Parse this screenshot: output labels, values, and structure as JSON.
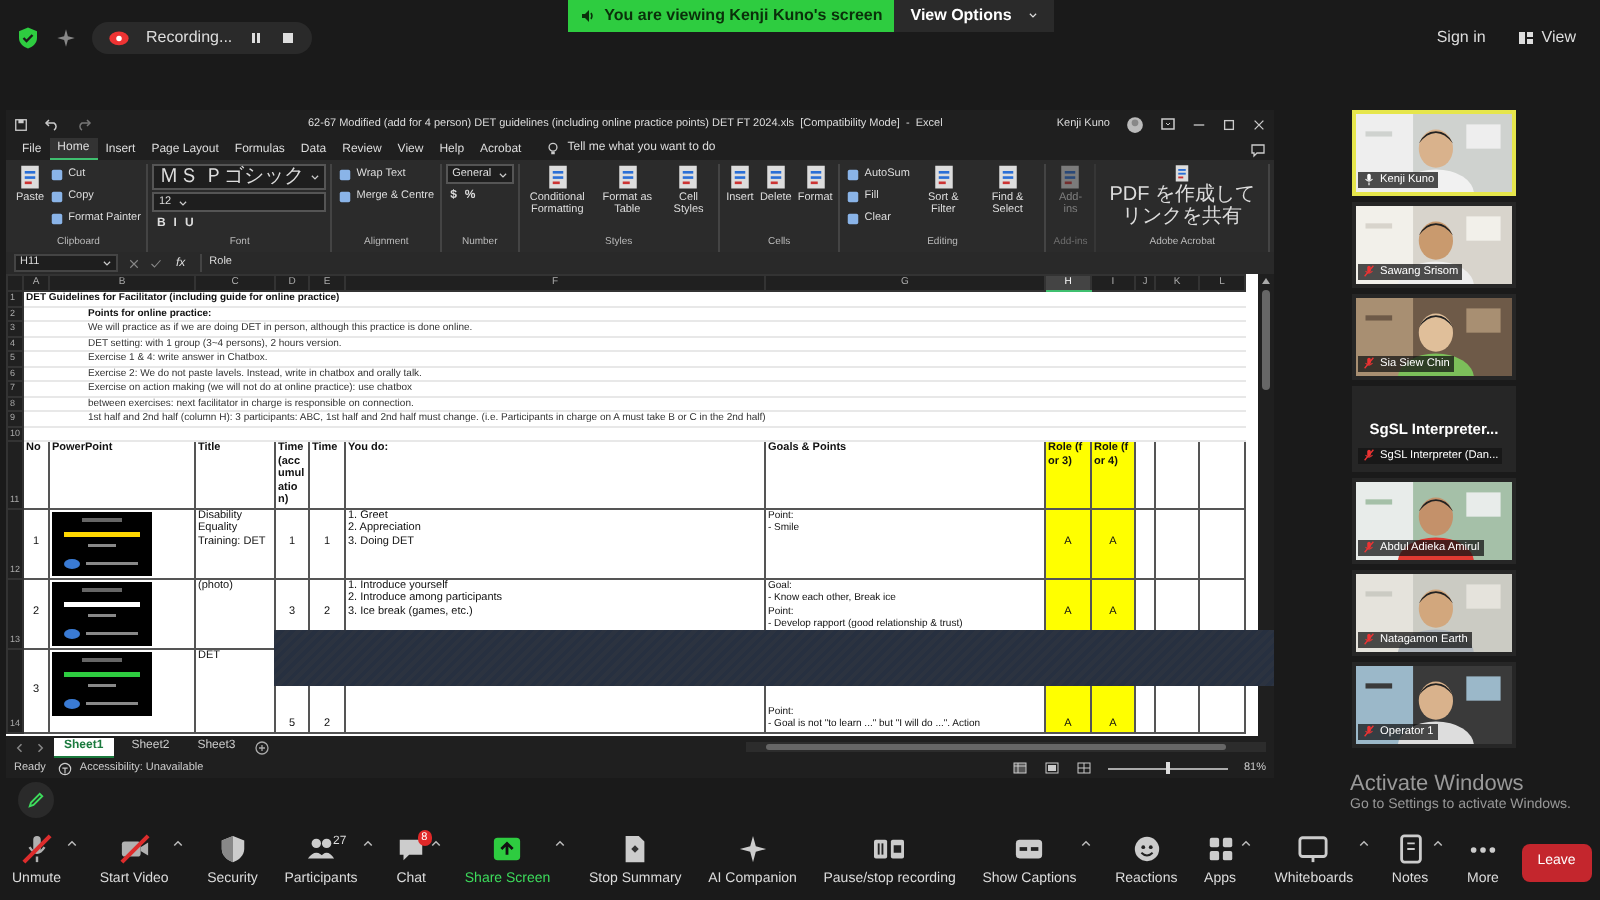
{
  "top_bar": {
    "recording": "Recording...",
    "banner": "You are viewing Kenji Kuno's screen",
    "view_options": "View Options",
    "sign_in": "Sign in",
    "view": "View"
  },
  "excel": {
    "title": "62-67 Modified (add for 4 person) DET guidelines (including online practice points) DET FT 2024.xls  [Compatibility Mode]  -  Excel",
    "user": "Kenji Kuno",
    "menu_tabs": [
      {
        "label": "File",
        "selected": false
      },
      {
        "label": "Home",
        "selected": true
      },
      {
        "label": "Insert",
        "selected": false
      },
      {
        "label": "Page Layout",
        "selected": false
      },
      {
        "label": "Formulas",
        "selected": false
      },
      {
        "label": "Data",
        "selected": false
      },
      {
        "label": "Review",
        "selected": false
      },
      {
        "label": "View",
        "selected": false
      },
      {
        "label": "Help",
        "selected": false
      },
      {
        "label": "Acrobat",
        "selected": false
      }
    ],
    "tell_me": "Tell me what you want to do",
    "ribbon": [
      {
        "label": "Clipboard",
        "disabled": false,
        "items": [
          {
            "kind": "large",
            "text": "Paste"
          },
          {
            "kind": "small",
            "text": "Cut"
          },
          {
            "kind": "small",
            "text": "Copy"
          },
          {
            "kind": "small",
            "text": "Format Painter"
          }
        ]
      },
      {
        "label": "Font",
        "disabled": false,
        "items": [
          {
            "kind": "select",
            "text": "ＭＳ Ｐゴシック"
          },
          {
            "kind": "select",
            "text": "12"
          },
          {
            "kind": "glyphs",
            "glyphs": [
              "B",
              "I",
              "U"
            ]
          }
        ]
      },
      {
        "label": "Alignment",
        "disabled": false,
        "items": [
          {
            "kind": "small",
            "text": "Wrap Text"
          },
          {
            "kind": "small",
            "text": "Merge & Centre"
          }
        ]
      },
      {
        "label": "Number",
        "disabled": false,
        "items": [
          {
            "kind": "select",
            "text": "General"
          },
          {
            "kind": "glyphs",
            "glyphs": [
              "$",
              "%"
            ]
          }
        ]
      },
      {
        "label": "Styles",
        "disabled": false,
        "items": [
          {
            "kind": "large",
            "text": "Conditional Formatting"
          },
          {
            "kind": "large",
            "text": "Format as Table"
          },
          {
            "kind": "large",
            "text": "Cell Styles"
          }
        ]
      },
      {
        "label": "Cells",
        "disabled": false,
        "items": [
          {
            "kind": "large",
            "text": "Insert"
          },
          {
            "kind": "large",
            "text": "Delete"
          },
          {
            "kind": "large",
            "text": "Format"
          }
        ]
      },
      {
        "label": "Editing",
        "disabled": false,
        "items": [
          {
            "kind": "small",
            "text": "AutoSum"
          },
          {
            "kind": "small",
            "text": "Fill"
          },
          {
            "kind": "small",
            "text": "Clear"
          },
          {
            "kind": "large",
            "text": "Sort & Filter"
          },
          {
            "kind": "large",
            "text": "Find & Select"
          }
        ]
      },
      {
        "label": "Add-ins",
        "disabled": true,
        "items": [
          {
            "kind": "large",
            "text": "Add-ins"
          }
        ]
      },
      {
        "label": "Adobe Acrobat",
        "disabled": false,
        "items": [
          {
            "kind": "large",
            "text": "PDF を作成してリンクを共有"
          }
        ]
      }
    ],
    "formula": {
      "cell": "H11",
      "fx": "fx",
      "value": "Role"
    },
    "columns": [
      {
        "label": "A",
        "selected": false
      },
      {
        "label": "B",
        "selected": false
      },
      {
        "label": "C",
        "selected": false
      },
      {
        "label": "D",
        "selected": false
      },
      {
        "label": "E",
        "selected": false
      },
      {
        "label": "F",
        "selected": false
      },
      {
        "label": "G",
        "selected": false
      },
      {
        "label": "H",
        "selected": true
      },
      {
        "label": "I",
        "selected": false
      },
      {
        "label": "J",
        "selected": false
      },
      {
        "label": "K",
        "selected": false
      },
      {
        "label": "L",
        "selected": false
      }
    ],
    "notes": [
      {
        "row": "1",
        "kind": "title",
        "text": "DET Guidelines for Facilitator (including guide for online practice)"
      },
      {
        "row": "2",
        "kind": "subtitle",
        "text": "Points for online practice:"
      },
      {
        "row": "3",
        "kind": "note",
        "text": "We will practice as if we are doing DET in person, although this practice is done online."
      },
      {
        "row": "4",
        "kind": "note",
        "text": "DET setting: with 1 group (3~4 persons), 2 hours version."
      },
      {
        "row": "5",
        "kind": "note",
        "text": "Exercise 1 & 4: write answer in Chatbox."
      },
      {
        "row": "6",
        "kind": "note",
        "text": "Exercise 2: We do not paste lavels. Instead, write in chatbox and orally talk."
      },
      {
        "row": "7",
        "kind": "note",
        "text": "Exercise on action making (we will not do at online practice): use chatbox"
      },
      {
        "row": "8",
        "kind": "note",
        "text": "between exercises: next facilitator in charge is responsible on connection."
      },
      {
        "row": "9",
        "kind": "note",
        "text": "1st half and 2nd half (column H): 3 participants: ABC, 1st half and 2nd half must change. (i.e. Participants in charge on A must take B or C in the 2nd half)"
      },
      {
        "row": "10",
        "kind": "empty"
      }
    ],
    "header": {
      "row": "11",
      "cells": [
        "No",
        "PowerPoint",
        "Title",
        "Time (accumulation)",
        "Time",
        "You do:",
        "Goals & Points",
        "Role (for 3)",
        "Role (for 4)"
      ]
    },
    "rows": [
      {
        "row": "12",
        "no": "1",
        "title": "Disability Equality Training: DET",
        "time_total": "1",
        "time": "1",
        "you_do": [
          "1. Greet",
          "2. Appreciation",
          "3. Doing DET"
        ],
        "goals": [
          "Point:",
          "- Smile"
        ],
        "role_3": "A",
        "role_4": "A"
      },
      {
        "row": "13",
        "no": "2",
        "title": "(photo)",
        "time_total": "3",
        "time": "2",
        "you_do": [
          "1. Introduce yourself",
          "2. Introduce among participants",
          "3. Ice break (games, etc.)"
        ],
        "goals": [
          "Goal:",
          "- Know each other, Break ice",
          "Point:",
          "- Develop rapport (good relationship & trust)"
        ],
        "role_3": "A",
        "role_4": "A"
      },
      {
        "row": "14",
        "no": "3",
        "title": "DET",
        "time_total": "5",
        "time": "2",
        "goals": [
          "Point:",
          "- Goal is not \"to learn ...\" but \"I will do ...\". Action"
        ],
        "role_3": "A",
        "role_4": "A"
      }
    ],
    "sheets": [
      {
        "label": "Sheet1",
        "selected": true
      },
      {
        "label": "Sheet2",
        "selected": false
      },
      {
        "label": "Sheet3",
        "selected": false
      }
    ],
    "status": "Ready",
    "accessibility": "Accessibility: Unavailable",
    "zoom_slider": {
      "level": 0.5,
      "reading": "81%"
    }
  },
  "gallery": [
    {
      "kind": "video",
      "name": "Kenji Kuno",
      "active_speaker": true,
      "muted": false
    },
    {
      "kind": "video",
      "name": "Sawang Srisom",
      "active_speaker": false,
      "muted": true
    },
    {
      "kind": "video",
      "name": "Sia Siew Chin",
      "active_speaker": false,
      "muted": true
    },
    {
      "kind": "name_card",
      "display": "SgSL  Interpreter...",
      "name": "SgSL Interpreter (Dan...",
      "active_speaker": false,
      "muted": true
    },
    {
      "kind": "video",
      "name": "Abdul Adieka Amirul",
      "active_speaker": false,
      "muted": true
    },
    {
      "kind": "video",
      "name": "Natagamon Earth",
      "active_speaker": false,
      "muted": true
    },
    {
      "kind": "video",
      "name": "Operator 1",
      "active_speaker": false,
      "muted": true
    }
  ],
  "windows_notice": {
    "title": "Activate Windows",
    "text": "Go to Settings to activate Windows."
  },
  "toolbar": [
    {
      "kind": "mic",
      "label": "Unmute",
      "crossed": true,
      "caret": true
    },
    {
      "kind": "video",
      "label": "Start Video",
      "crossed": true,
      "caret": true
    },
    {
      "kind": "shield",
      "label": "Security",
      "crossed": false,
      "caret": false
    },
    {
      "kind": "people",
      "label": "Participants",
      "count": "27",
      "crossed": false,
      "caret": true
    },
    {
      "kind": "chat",
      "label": "Chat",
      "badge": "8",
      "crossed": false,
      "caret": true
    },
    {
      "kind": "share",
      "label": "Share Screen",
      "crossed": false,
      "caret": true
    },
    {
      "kind": "summary",
      "label": "Stop Summary",
      "crossed": false,
      "caret": false
    },
    {
      "kind": "sparkle",
      "label": "AI Companion",
      "crossed": false,
      "caret": false
    },
    {
      "kind": "record",
      "label": "Pause/stop recording",
      "crossed": false,
      "caret": false
    },
    {
      "kind": "captions",
      "label": "Show Captions",
      "crossed": false,
      "caret": true
    },
    {
      "kind": "reactions",
      "label": "Reactions",
      "crossed": false,
      "caret": false
    },
    {
      "kind": "apps",
      "label": "Apps",
      "crossed": false,
      "caret": true
    },
    {
      "kind": "whiteboard",
      "label": "Whiteboards",
      "crossed": false,
      "caret": true
    },
    {
      "kind": "notes",
      "label": "Notes",
      "crossed": false,
      "caret": true
    },
    {
      "kind": "more",
      "label": "More",
      "crossed": false,
      "caret": false
    },
    {
      "kind": "leave",
      "label": "Leave"
    }
  ]
}
